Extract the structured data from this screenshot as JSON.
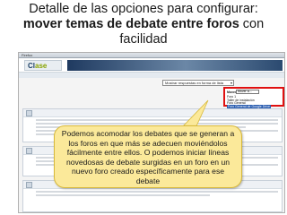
{
  "slide": {
    "title_line1": "Detalle de las opciones para configurar:",
    "title_line2_bold": "mover temas de debate entre foros",
    "title_line2_rest": " con",
    "title_line3": "facilidad"
  },
  "browser": {
    "tab_label": "Firefox"
  },
  "site": {
    "logo_main": "Cl",
    "logo_accent": "ase"
  },
  "forum": {
    "discussion_select": "Mostrar respuestas en forma de lista",
    "move_label": "Mover",
    "move_select": "Mover a...",
    "move_options": [
      "Foro 1",
      "Taller de instalación",
      "Foro General",
      "Foro General de Google Drive"
    ],
    "move_selected_option": "Foro General de Google Drive"
  },
  "callout": {
    "text": "Podemos acomodar los debates que se generan a los foros en que más se adecuen moviéndolos fácilmente entre ellos. O podemos iniciar líneas novedosas de debate surgidas en un foro en un nuevo foro creado específicamente para ese debate"
  }
}
